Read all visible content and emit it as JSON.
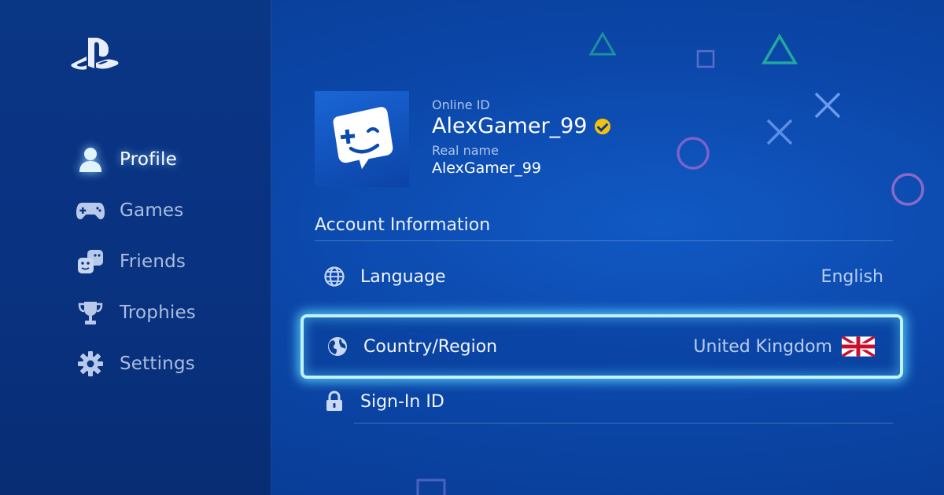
{
  "sidebar": {
    "items": [
      {
        "label": "Profile",
        "icon": "person-icon",
        "active": true
      },
      {
        "label": "Games",
        "icon": "gamepad-icon",
        "active": false
      },
      {
        "label": "Friends",
        "icon": "friends-icon",
        "active": false
      },
      {
        "label": "Trophies",
        "icon": "trophy-icon",
        "active": false
      },
      {
        "label": "Settings",
        "icon": "gear-icon",
        "active": false
      }
    ]
  },
  "profile": {
    "online_id_label": "Online ID",
    "online_id": "AlexGamer_99",
    "real_name_label": "Real name",
    "real_name": "AlexGamer_99"
  },
  "account": {
    "section_title": "Account Information",
    "rows": [
      {
        "label": "Language",
        "value": "English",
        "icon": "globe-icon"
      },
      {
        "label": "Country/Region",
        "value": "United Kingdom",
        "icon": "earth-icon",
        "flag": "uk-flag-icon",
        "focused": true
      },
      {
        "label": "Sign-In ID",
        "value": "",
        "icon": "lock-icon"
      }
    ]
  },
  "colors": {
    "background": "#0b46a8",
    "sidebar": "#093280",
    "focus_glow": "#5ad2ff",
    "verified_badge": "#f5c20b"
  }
}
